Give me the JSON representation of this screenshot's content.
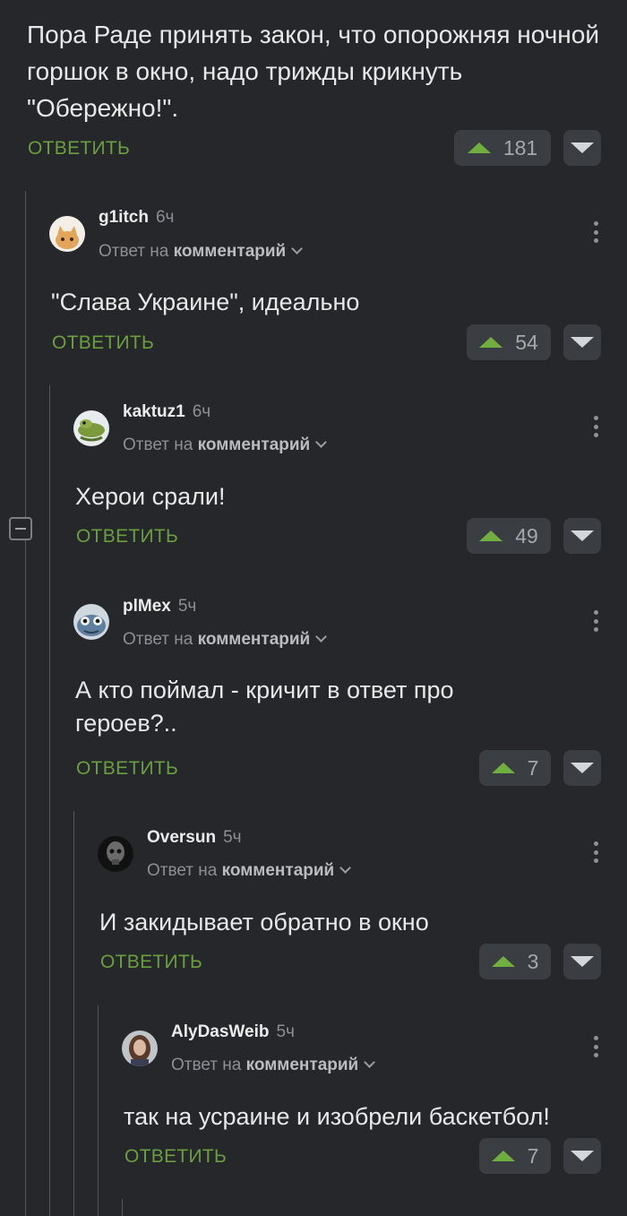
{
  "parent_comment": {
    "text": "Пора Раде принять закон, что опорожняя ночной горшок в окно, надо трижды крикнуть \"Обережно!\".",
    "reply_label": "ОТВЕТИТЬ",
    "votes": "181"
  },
  "comments": [
    {
      "author": "g1itch",
      "time": "6ч",
      "answer_prefix": "Ответ на",
      "answer_link": "комментарий",
      "text": "\"Слава Украине\", идеально",
      "reply_label": "ОТВЕТИТЬ",
      "votes": "54",
      "avatar_icon": "cat-avatar-icon"
    },
    {
      "author": "kaktuz1",
      "time": "6ч",
      "answer_prefix": "Ответ на",
      "answer_link": "комментарий",
      "text": "Херои срали!",
      "reply_label": "ОТВЕТИТЬ",
      "votes": "49",
      "avatar_icon": "lizard-avatar-icon"
    },
    {
      "author": "plMex",
      "time": "5ч",
      "answer_prefix": "Ответ на",
      "answer_link": "комментарий",
      "text": "А кто поймал - кричит в ответ про героев?..",
      "reply_label": "ОТВЕТИТЬ",
      "votes": "7",
      "avatar_icon": "creature-avatar-icon"
    },
    {
      "author": "Oversun",
      "time": "5ч",
      "answer_prefix": "Ответ на",
      "answer_link": "комментарий",
      "text": "И закидывает обратно в окно",
      "reply_label": "ОТВЕТИТЬ",
      "votes": "3",
      "avatar_icon": "skull-avatar-icon"
    },
    {
      "author": "AlyDasWeib",
      "time": "5ч",
      "answer_prefix": "Ответ на",
      "answer_link": "комментарий",
      "text": "так на усраине и изобрели баскетбол!",
      "reply_label": "ОТВЕТИТЬ",
      "votes": "7",
      "avatar_icon": "portrait-avatar-icon"
    }
  ],
  "colors": {
    "accent_green": "#6a9f3e",
    "upvote": "#6fae3f",
    "background": "#25272a"
  }
}
